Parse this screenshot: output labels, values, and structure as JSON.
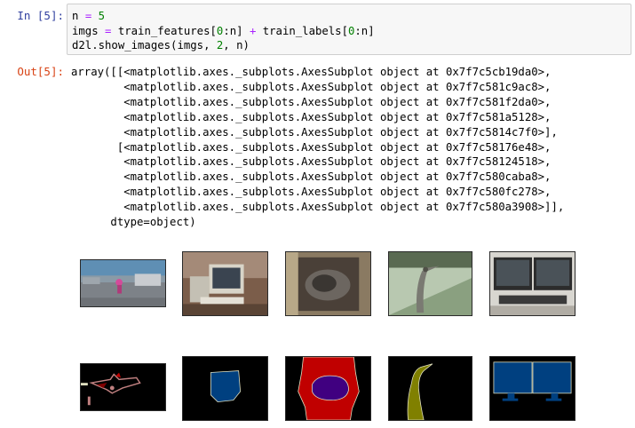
{
  "cell": {
    "in_prompt": "In [5]:",
    "out_prompt": "Out[5]:",
    "code": {
      "line1": {
        "a": "n ",
        "b": "=",
        "c": " ",
        "d": "5"
      },
      "line2": {
        "a": "imgs ",
        "b": "=",
        "c": " train_features[",
        "d": "0",
        "e": ":n] ",
        "f": "+",
        "g": " train_labels[",
        "h": "0",
        "i": ":n]"
      },
      "line3": {
        "a": "d2l.show_images(imgs, ",
        "b": "2",
        "c": ", n)"
      }
    },
    "output_lines": [
      "array([[<matplotlib.axes._subplots.AxesSubplot object at 0x7f7c5cb19da0>,",
      "        <matplotlib.axes._subplots.AxesSubplot object at 0x7f7c581c9ac8>,",
      "        <matplotlib.axes._subplots.AxesSubplot object at 0x7f7c581f2da0>,",
      "        <matplotlib.axes._subplots.AxesSubplot object at 0x7f7c581a5128>,",
      "        <matplotlib.axes._subplots.AxesSubplot object at 0x7f7c5814c7f0>],",
      "       [<matplotlib.axes._subplots.AxesSubplot object at 0x7f7c58176e48>,",
      "        <matplotlib.axes._subplots.AxesSubplot object at 0x7f7c58124518>,",
      "        <matplotlib.axes._subplots.AxesSubplot object at 0x7f7c580caba8>,",
      "        <matplotlib.axes._subplots.AxesSubplot object at 0x7f7c580fc278>,",
      "        <matplotlib.axes._subplots.AxesSubplot object at 0x7f7c580a3908>]],",
      "      dtype=object)"
    ]
  },
  "colors": {
    "in_prompt": "#303F9F",
    "out_prompt": "#D84315",
    "code_bg": "#f7f7f7",
    "operator": "#AA22FF",
    "number": "#008000",
    "label_background": "#000000",
    "label_aeroplane": "#800000",
    "label_person": "#C08080",
    "label_tvmonitor": "#004080",
    "label_cat": "#400080",
    "label_chair": "#C00000",
    "label_bird": "#808000",
    "label_boundary": "#E0E0C0"
  },
  "figure": {
    "rows": [
      {
        "kind": "photo",
        "items": [
          "runway-photo",
          "computer-photo",
          "cat-on-chair-photo",
          "heron-photo",
          "dual-monitor-photo"
        ]
      },
      {
        "kind": "segmentation-label",
        "items": [
          "runway-label",
          "computer-label",
          "cat-on-chair-label",
          "heron-label",
          "dual-monitor-label"
        ]
      }
    ]
  }
}
